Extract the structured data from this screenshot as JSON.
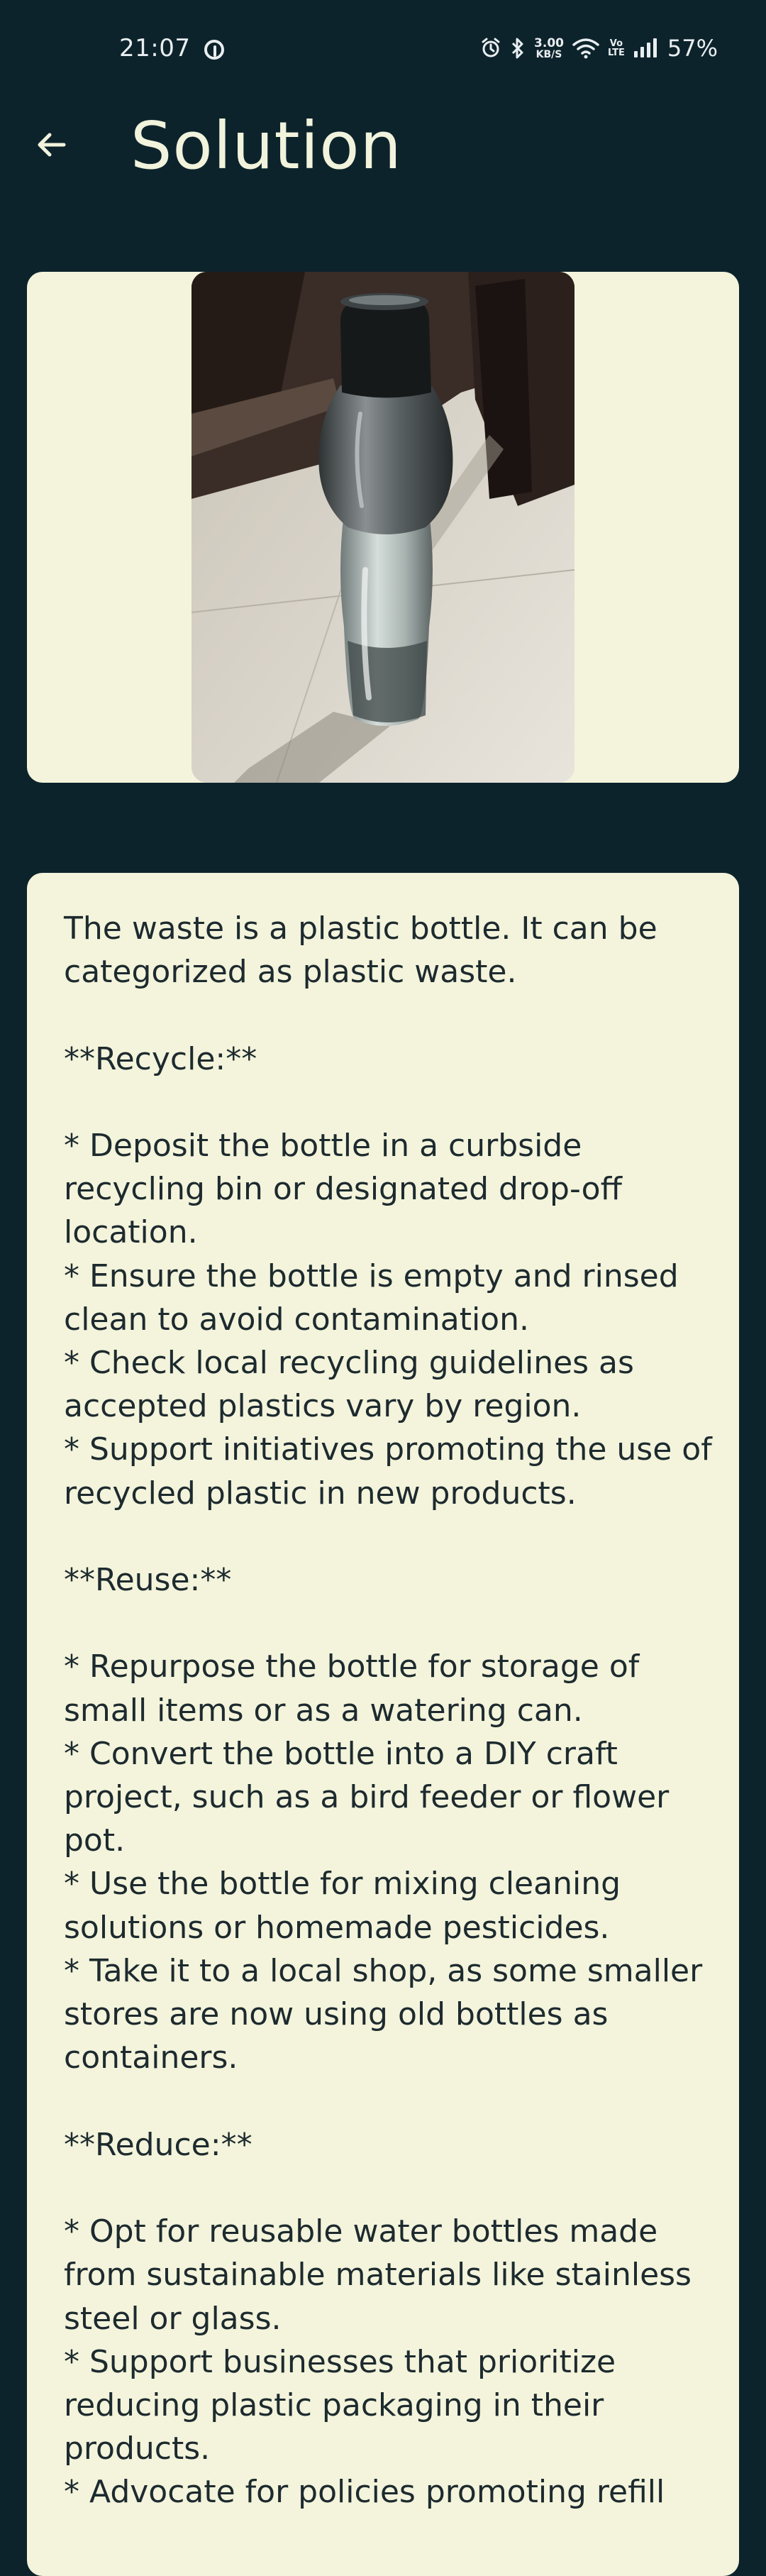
{
  "status_bar": {
    "time": "21:07",
    "network_speed_value": "3.00",
    "network_speed_unit": "KB/S",
    "volte_top": "Vo",
    "volte_bottom": "LTE",
    "battery": "57%"
  },
  "app_bar": {
    "title": "Solution"
  },
  "content": {
    "solution_text": "The waste is a plastic bottle. It can be categorized as plastic waste.\n\n**Recycle:**\n\n* Deposit the bottle in a curbside recycling bin or designated drop-off location.\n* Ensure the bottle is empty and rinsed clean to avoid contamination.\n* Check local recycling guidelines as accepted plastics vary by region.\n* Support initiatives promoting the use of recycled plastic in new products.\n\n**Reuse:**\n\n* Repurpose the bottle for storage of small items or as a watering can.\n* Convert the bottle into a DIY craft project, such as a bird feeder or flower pot.\n* Use the bottle for mixing cleaning solutions or homemade pesticides.\n* Take it to a local shop, as some smaller stores are now using old bottles as containers.\n\n**Reduce:**\n\n* Opt for reusable water bottles made from sustainable materials like stainless steel or glass.\n* Support businesses that prioritize reducing plastic packaging in their products.\n* Advocate for policies promoting refill"
  },
  "colors": {
    "background": "#0d232c",
    "card": "#f3f4db",
    "title": "#f1f3dc",
    "text": "#1d2a2f"
  }
}
